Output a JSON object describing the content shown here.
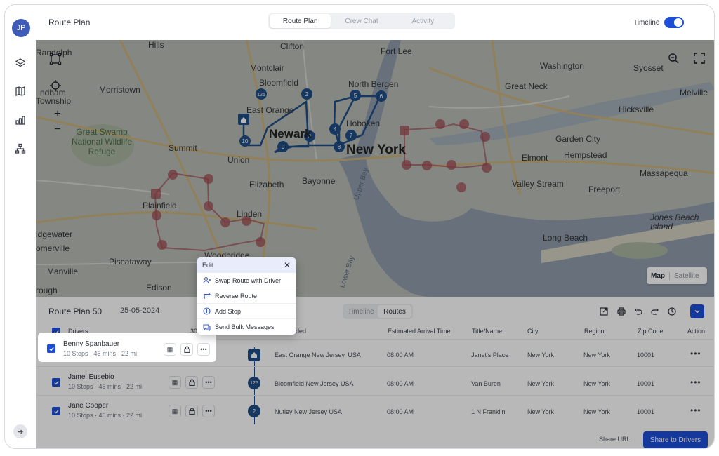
{
  "user": {
    "initials": "JP"
  },
  "header": {
    "title": "Route Plan",
    "tabs": [
      "Route Plan",
      "Crew Chat",
      "Activity"
    ],
    "active_tab": "Route Plan",
    "timeline_label": "Timeline",
    "timeline_on": true
  },
  "rail": {
    "items": [
      "layers-icon",
      "map-icon",
      "chart-icon",
      "hierarchy-icon"
    ],
    "expand": "arrow-right-icon"
  },
  "map": {
    "places": {
      "randolph": "Randolph",
      "hills": "Hills",
      "clifton": "Clifton",
      "fortlee": "Fort Lee",
      "montclair": "Montclair",
      "bloomfield": "Bloomfield",
      "northbergen": "North Bergen",
      "greatneck": "Great Neck",
      "washington": "Washington",
      "syosset": "Syosset",
      "melville": "Melville",
      "morristown": "Morristown",
      "ndham": "ndham",
      "township": "Township",
      "eastorange": "East Orange",
      "hoboken": "Hoboken",
      "newark": "Newark",
      "newyork": "New York",
      "hicksville": "Hicksville",
      "greatswamp": "Great Swamp National Wildlife Refuge",
      "summit": "Summit",
      "union": "Union",
      "gardencity": "Garden City",
      "elmont": "Elmont",
      "hempstead": "Hempstead",
      "bayonne": "Bayonne",
      "massapequa": "Massapequa",
      "elizabeth": "Elizabeth",
      "valleystream": "Valley Stream",
      "freeport": "Freeport",
      "plainfield": "Plainfield",
      "linden": "Linden",
      "jonesbeach": "Jones Beach Island",
      "idgewater": "idgewater",
      "omerville": "omerville",
      "woodbridge": "Woodbridge",
      "longbeach": "Long Beach",
      "piscataway": "Piscataway",
      "manville": "Manville",
      "edison": "Edison",
      "rough": "rough",
      "upperbay": "Upper Bay",
      "lowerbay": "Lower Bay"
    },
    "map_type": {
      "map": "Map",
      "satellite": "Satellite"
    },
    "stops": [
      "125",
      "2",
      "5",
      "6",
      "4",
      "7",
      "3",
      "8",
      "9",
      "10"
    ]
  },
  "popup": {
    "title": "Edit",
    "items": [
      "Swap Route with Driver",
      "Reverse Route",
      "Add Stop",
      "Send Bulk Messages"
    ]
  },
  "panel": {
    "title": "Route Plan 50",
    "date": "25-05-2024",
    "tabs": [
      "Timeline",
      "Routes"
    ],
    "active_tab": "Routes",
    "drivers_header": "Drivers",
    "columns": {
      "time": "30",
      "added": "ded",
      "eta": "Estimated Arrival Time",
      "title": "Title/Name",
      "city": "City",
      "region": "Region",
      "zip": "Zip Code",
      "action": "Action"
    },
    "drivers": [
      {
        "name": "Benny Spanbauer",
        "stops": "10 Stops",
        "mins": "46 mins",
        "miles": "22 mi"
      },
      {
        "name": "Jamel Eusebio",
        "stops": "10 Stops",
        "mins": "46 mins",
        "miles": "22 mi"
      },
      {
        "name": "Jane Cooper",
        "stops": "10 Stops",
        "mins": "46 mins",
        "miles": "22 mi"
      }
    ],
    "rows": [
      {
        "marker": "home",
        "address": "East Orange New Jersey, USA",
        "eta": "08:00 AM",
        "title": "Janet's Place",
        "city": "New York",
        "region": "New York",
        "zip": "10001"
      },
      {
        "marker": "125",
        "address": "Bloomfield New Jersey USA",
        "eta": "08:00 AM",
        "title": "Van Buren",
        "city": "New York",
        "region": "New York",
        "zip": "10001"
      },
      {
        "marker": "2",
        "address": "Nutley New Jersey USA",
        "eta": "08:00 AM",
        "title": "1 N Franklin",
        "city": "New York",
        "region": "New York",
        "zip": "10001"
      }
    ],
    "share_url": "Share URL",
    "share_button": "Share to Drivers"
  },
  "colors": {
    "accent": "#1d4ed8",
    "route_blue": "#1f4e86",
    "route_red": "#a14d55"
  }
}
